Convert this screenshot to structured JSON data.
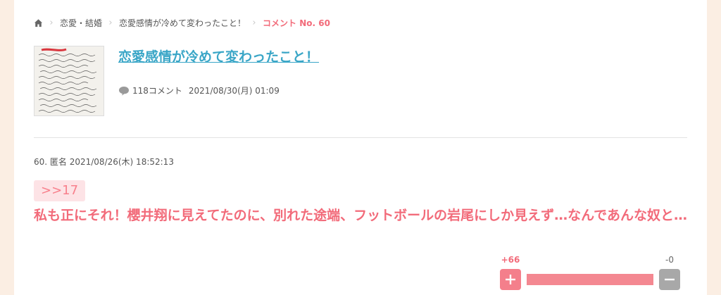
{
  "breadcrumb": {
    "home_icon": "home-icon",
    "items": [
      "恋愛・結婚",
      "恋愛感情が冷めて変わったこと！"
    ],
    "current": "コメント No. 60"
  },
  "topic": {
    "title": "恋愛感情が冷めて変わったこと！",
    "comment_count": "118コメント",
    "date": "2021/08/30(月) 01:09",
    "thumbnail": "handwritten-note-image"
  },
  "comment": {
    "header": "60. 匿名 2021/08/26(木) 18:52:13",
    "anchor": ">>17",
    "text": "私も正にそれ！櫻井翔に見えてたのに、別れた途端、フットボールの岩尾にしか見えず…なんであんな奴と…"
  },
  "vote": {
    "plus_label": "+66",
    "minus_label": "-0",
    "plus_ratio": 1.0
  },
  "colors": {
    "accent": "#f26b7a",
    "link": "#3aa6c7",
    "background": "#fbeee3"
  }
}
